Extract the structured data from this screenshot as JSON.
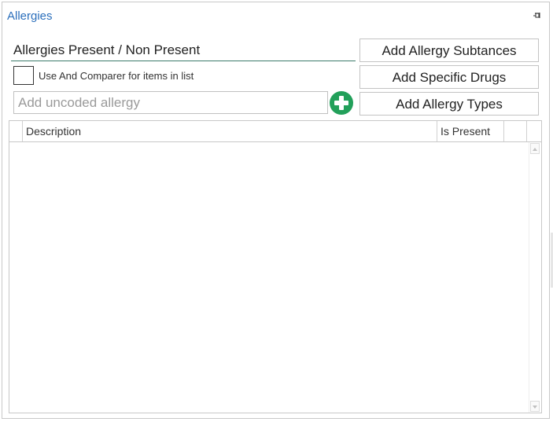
{
  "panel": {
    "title": "Allergies"
  },
  "form": {
    "status_label": "Allergies Present / Non Present",
    "comparer_label": "Use And Comparer for items in list",
    "comparer_checked": false,
    "uncoded_placeholder": "Add uncoded allergy",
    "uncoded_value": ""
  },
  "buttons": {
    "add_substances": "Add Allergy Subtances",
    "add_drugs": "Add Specific Drugs",
    "add_types": "Add Allergy Types"
  },
  "grid": {
    "columns": [
      "Description",
      "Is Present"
    ],
    "rows": []
  },
  "colors": {
    "title": "#2a6ebb",
    "plus_button": "#22a05a",
    "underline": "#3c7a6a"
  },
  "icons": {
    "pin": "pin-icon",
    "add": "plus-circle-icon"
  }
}
